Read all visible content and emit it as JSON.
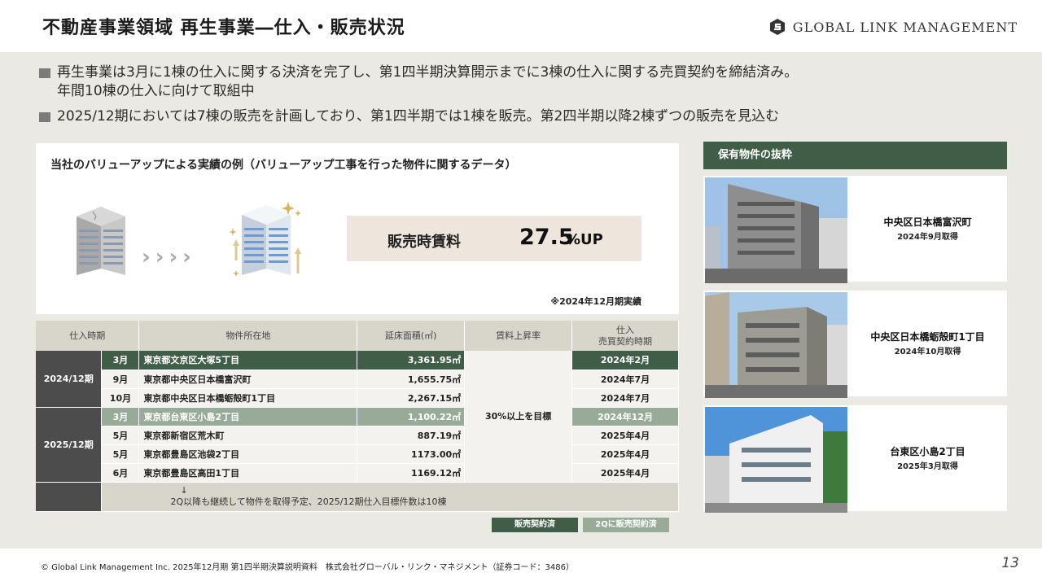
{
  "header": {
    "title": "不動産事業領域 再生事業―仕入・販売状況",
    "logo_text": "GLOBAL LINK MANAGEMENT"
  },
  "bullets": [
    "再生事業は3月に1棟の仕入に関する決済を完了し、第1四半期決算開示までに3棟の仕入に関する売買契約を締結済み。\n年間10棟の仕入に向けて取組中",
    "2025/12期においては7棟の販売を計画しており、第1四半期では1棟を販売。第2四半期以降2棟ずつの販売を見込む"
  ],
  "value_up": {
    "heading": "当社のバリューアップによる実績の例（バリューアップ工事を行った物件に関するデータ）",
    "kpi_label": "販売時賃料",
    "kpi_value": "27.5",
    "kpi_unit": "%UP",
    "note": "※2024年12月期実績"
  },
  "table": {
    "headers": {
      "period": "仕入時期",
      "location": "物件所在地",
      "area": "延床面積(㎡)",
      "rent": "賃料上昇率",
      "sale_line1": "仕入",
      "sale_line2": "売買契約時期"
    },
    "groups": [
      {
        "period": "2024/12期",
        "rows": [
          {
            "month": "3月",
            "location": "東京都文京区大塚5丁目",
            "area": "3,361.95㎡",
            "sale": "2024年2月",
            "status": "dark"
          },
          {
            "month": "9月",
            "location": "東京都中央区日本橋富沢町",
            "area": "1,655.75㎡",
            "sale": "2024年7月",
            "status": "none"
          },
          {
            "month": "10月",
            "location": "東京都中央区日本橋蛎殻町1丁目",
            "area": "2,267.15㎡",
            "sale": "2024年7月",
            "status": "none"
          }
        ]
      },
      {
        "period": "2025/12期",
        "rows": [
          {
            "month": "3月",
            "location": "東京都台東区小島2丁目",
            "area": "1,100.22㎡",
            "sale": "2024年12月",
            "status": "light"
          },
          {
            "month": "5月",
            "location": "東京都新宿区荒木町",
            "area": "887.19㎡",
            "sale": "2025年4月",
            "status": "none"
          },
          {
            "month": "5月",
            "location": "東京都豊島区池袋2丁目",
            "area": "1173.00㎡",
            "sale": "2025年4月",
            "status": "none"
          },
          {
            "month": "6月",
            "location": "東京都豊島区高田1丁目",
            "area": "1169.12㎡",
            "sale": "2025年4月",
            "status": "none"
          }
        ]
      }
    ],
    "rent_value": "30%以上を目標",
    "footer_arrow": "↓",
    "footer_text": "2Q以降も継続して物件を取得予定、2025/12期仕入目標件数は10棟"
  },
  "legend": {
    "sold": "販売契約済",
    "q2_sold": "2Qに販売契約済"
  },
  "properties": {
    "heading": "保有物件の抜粋",
    "items": [
      {
        "name": "中央区日本橋富沢町",
        "date": "2024年9月取得"
      },
      {
        "name": "中央区日本橋蛎殻町1丁目",
        "date": "2024年10月取得"
      },
      {
        "name": "台東区小島2丁目",
        "date": "2025年3月取得"
      }
    ]
  },
  "footer": {
    "copyright": "© Global Link Management Inc. 2025年12月期 第1四半期決算説明資料　株式会社グローバル・リンク・マネジメント（証券コード：3486）",
    "page_number": "13"
  },
  "colors": {
    "dark_green": "#405e47",
    "light_green": "#98ab98",
    "beige": "#ebe9e3",
    "header_gray": "#d8d5ca"
  }
}
